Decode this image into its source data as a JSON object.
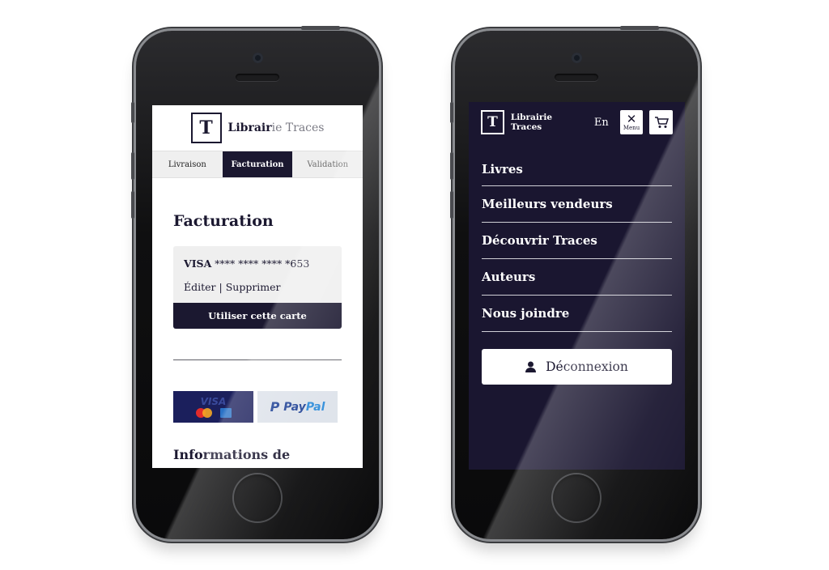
{
  "left_phone": {
    "brand": {
      "logo_letter": "T",
      "name_bold": "Librair",
      "name_rest": "ie Traces"
    },
    "steps": [
      {
        "label": "Livraison",
        "active": false
      },
      {
        "label": "Facturation",
        "active": true
      },
      {
        "label": "Validation",
        "active": false
      }
    ],
    "section_title": "Facturation",
    "card": {
      "brand": "VISA",
      "masked_number": "**** **** **** *653",
      "edit_label": "Éditer",
      "separator": "|",
      "delete_label": "Supprimer",
      "use_button_label": "Utiliser cette carte"
    },
    "payment_options": {
      "visa_logo_text": "VISA",
      "paypal_mark": "P",
      "paypal_word_1": "Pay",
      "paypal_word_2": "Pal"
    },
    "info_title": "Informations de"
  },
  "right_phone": {
    "brand": {
      "logo_letter": "T",
      "name": "Librairie Traces"
    },
    "lang": "En",
    "menu_button": {
      "icon": "close-icon",
      "label": "Menu"
    },
    "cart_icon": "cart-icon",
    "nav_items": [
      "Livres",
      "Meilleurs vendeurs",
      "Découvrir Traces",
      "Auteurs",
      "Nous joindre"
    ],
    "logout_label": "Déconnexion",
    "logout_icon": "user-icon"
  },
  "colors": {
    "accent": "#1b1830",
    "menu_bg": "#1a1630",
    "step_inactive": "#efefef",
    "paypal_blue": "#1c3f94"
  }
}
